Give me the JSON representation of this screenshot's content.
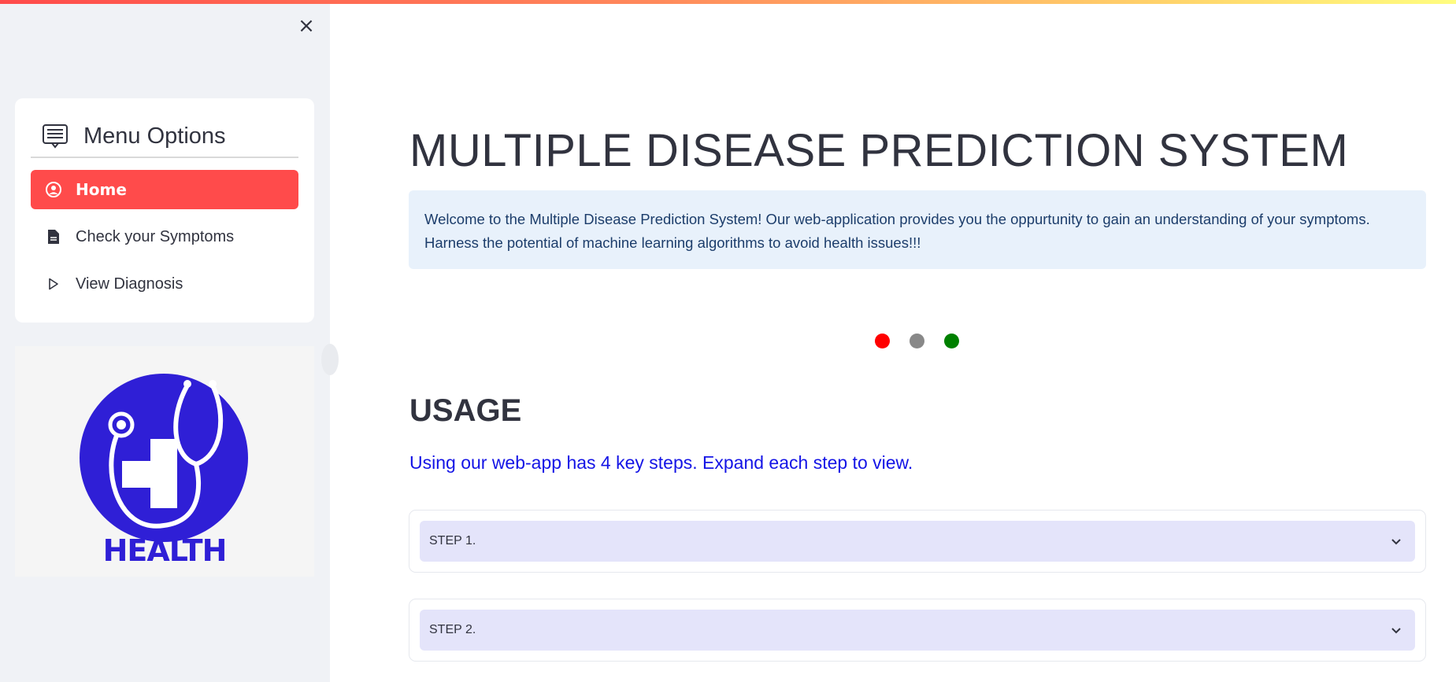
{
  "sidebar": {
    "close_label": "×",
    "menu_title": "Menu Options",
    "items": [
      {
        "label": "Home",
        "icon": "person-circle-icon",
        "active": true
      },
      {
        "label": "Check your Symptoms",
        "icon": "document-icon",
        "active": false
      },
      {
        "label": "View Diagnosis",
        "icon": "play-outline-icon",
        "active": false
      }
    ],
    "logo": {
      "text": "HEALTH",
      "icon": "stethoscope-cross-icon",
      "color": "#2f1fd6"
    }
  },
  "main": {
    "title": "MULTIPLE DISEASE PREDICTION SYSTEM",
    "info_line1": "Welcome to the Multiple Disease Prediction System! Our web-application provides you the oppurtunity to gain an understanding of your symptoms.",
    "info_line2": "Harness the potential of machine learning algorithms to avoid health issues!!!",
    "dots": [
      {
        "color": "#ff0000"
      },
      {
        "color": "#888888"
      },
      {
        "color": "#008000"
      }
    ],
    "usage_title": "USAGE",
    "usage_subtitle": "Using our web-app has 4 key steps. Expand each step to view.",
    "steps": [
      {
        "label": "STEP 1."
      },
      {
        "label": "STEP 2."
      }
    ]
  },
  "colors": {
    "accent": "#ff4b4b",
    "info_bg": "#e8f1fb",
    "expander_bg": "#e4e4fa",
    "subtitle_blue": "#1414e6"
  }
}
